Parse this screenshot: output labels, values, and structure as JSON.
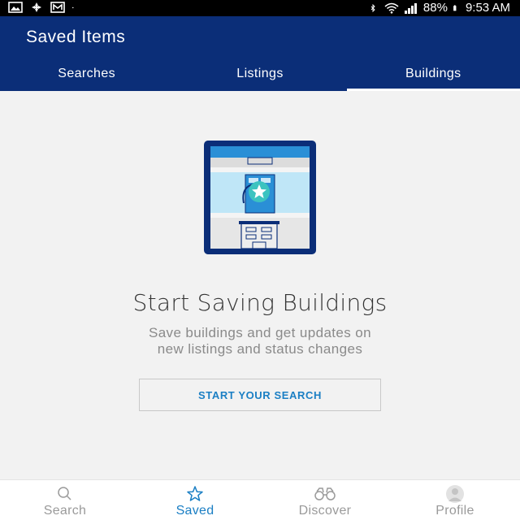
{
  "status_bar": {
    "battery": "88%",
    "time": "9:53 AM"
  },
  "header": {
    "title": "Saved Items",
    "tabs": [
      {
        "label": "Searches",
        "active": false
      },
      {
        "label": "Listings",
        "active": false
      },
      {
        "label": "Buildings",
        "active": true
      }
    ]
  },
  "empty_state": {
    "title": "Start Saving Buildings",
    "description_line1": "Save buildings and get updates on",
    "description_line2": "new listings and status changes",
    "cta_label": "START YOUR SEARCH"
  },
  "bottom_nav": {
    "items": [
      {
        "label": "Search",
        "icon": "search-icon",
        "active": false
      },
      {
        "label": "Saved",
        "icon": "star-icon",
        "active": true
      },
      {
        "label": "Discover",
        "icon": "binoculars-icon",
        "active": false
      },
      {
        "label": "Profile",
        "icon": "profile-icon",
        "active": false
      }
    ]
  },
  "colors": {
    "header_bg": "#0b2e78",
    "accent": "#1b7fc4",
    "content_bg": "#f2f2f2"
  }
}
